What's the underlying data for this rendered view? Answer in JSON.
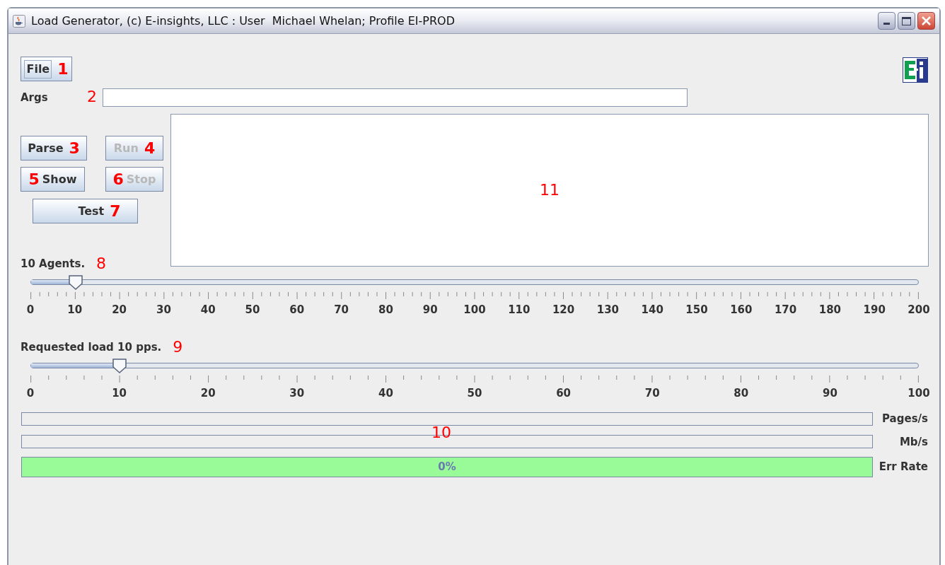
{
  "window": {
    "title": "Load Generator, (c) E-insights, LLC : User  Michael Whelan; Profile EI-PROD"
  },
  "file_button": {
    "label": "File",
    "enabled": true,
    "callout": "1"
  },
  "args": {
    "label": "Args",
    "callout": "2"
  },
  "buttons": [
    {
      "label": "Parse",
      "enabled": true,
      "callout_after": "3"
    },
    {
      "label": "Run",
      "enabled": false,
      "callout_after": "4"
    },
    {
      "label": "Show",
      "enabled": true,
      "callout_before": "5"
    },
    {
      "label": "Stop",
      "enabled": false,
      "callout_before": "6"
    },
    {
      "label": "Test",
      "enabled": true,
      "callout_after": "7"
    }
  ],
  "output": {
    "callout": "11"
  },
  "sliders": [
    {
      "label": "10 Agents.",
      "callout": "8",
      "level": 0.05,
      "labels": [
        "0",
        "10",
        "20",
        "30",
        "40",
        "50",
        "60",
        "70",
        "80",
        "90",
        "100",
        "110",
        "120",
        "130",
        "140",
        "150",
        "160",
        "170",
        "180",
        "190",
        "200"
      ]
    },
    {
      "label": "Requested load 10 pps.",
      "callout": "9",
      "level": 0.1,
      "labels": [
        "0",
        "10",
        "20",
        "30",
        "40",
        "50",
        "60",
        "70",
        "80",
        "90",
        "100"
      ]
    }
  ],
  "meters": {
    "callout": "10",
    "bars": [
      {
        "label": "Pages/s",
        "ok": false
      },
      {
        "label": "Mb/s",
        "ok": false
      },
      {
        "label": "Err Rate",
        "ok": true,
        "reading": "0%"
      }
    ]
  }
}
